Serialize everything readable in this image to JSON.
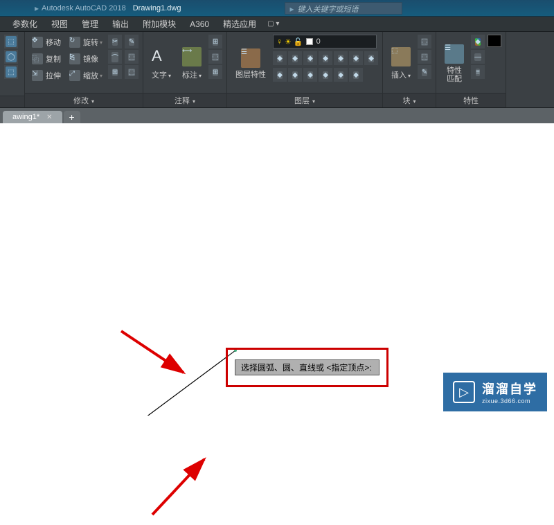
{
  "title": {
    "app_name": "Autodesk AutoCAD 2018",
    "doc_name": "Drawing1.dwg",
    "search_placeholder": "键入关键字或短语"
  },
  "menu": {
    "items": [
      "参数化",
      "视图",
      "管理",
      "输出",
      "附加模块",
      "A360",
      "精选应用"
    ]
  },
  "ribbon": {
    "modify": {
      "title": "修改",
      "move": "移动",
      "rotate": "旋转",
      "copy": "复制",
      "mirror": "镜像",
      "stretch": "拉伸",
      "scale": "缩放"
    },
    "annotate": {
      "title": "注释",
      "text": "文字",
      "dim": "标注"
    },
    "layers": {
      "title": "图层",
      "layer_prop": "图层特性",
      "current": "0"
    },
    "block": {
      "title": "块",
      "insert": "插入"
    },
    "props": {
      "title": "特性",
      "prop": "特性",
      "match": "匹配"
    }
  },
  "tabs": {
    "active": "awing1*"
  },
  "canvas": {
    "prompt": "选择圆弧、圆、直线或 <指定顶点>:"
  },
  "watermark": {
    "cn": "溜溜自学",
    "url": "zixue.3d66.com"
  }
}
